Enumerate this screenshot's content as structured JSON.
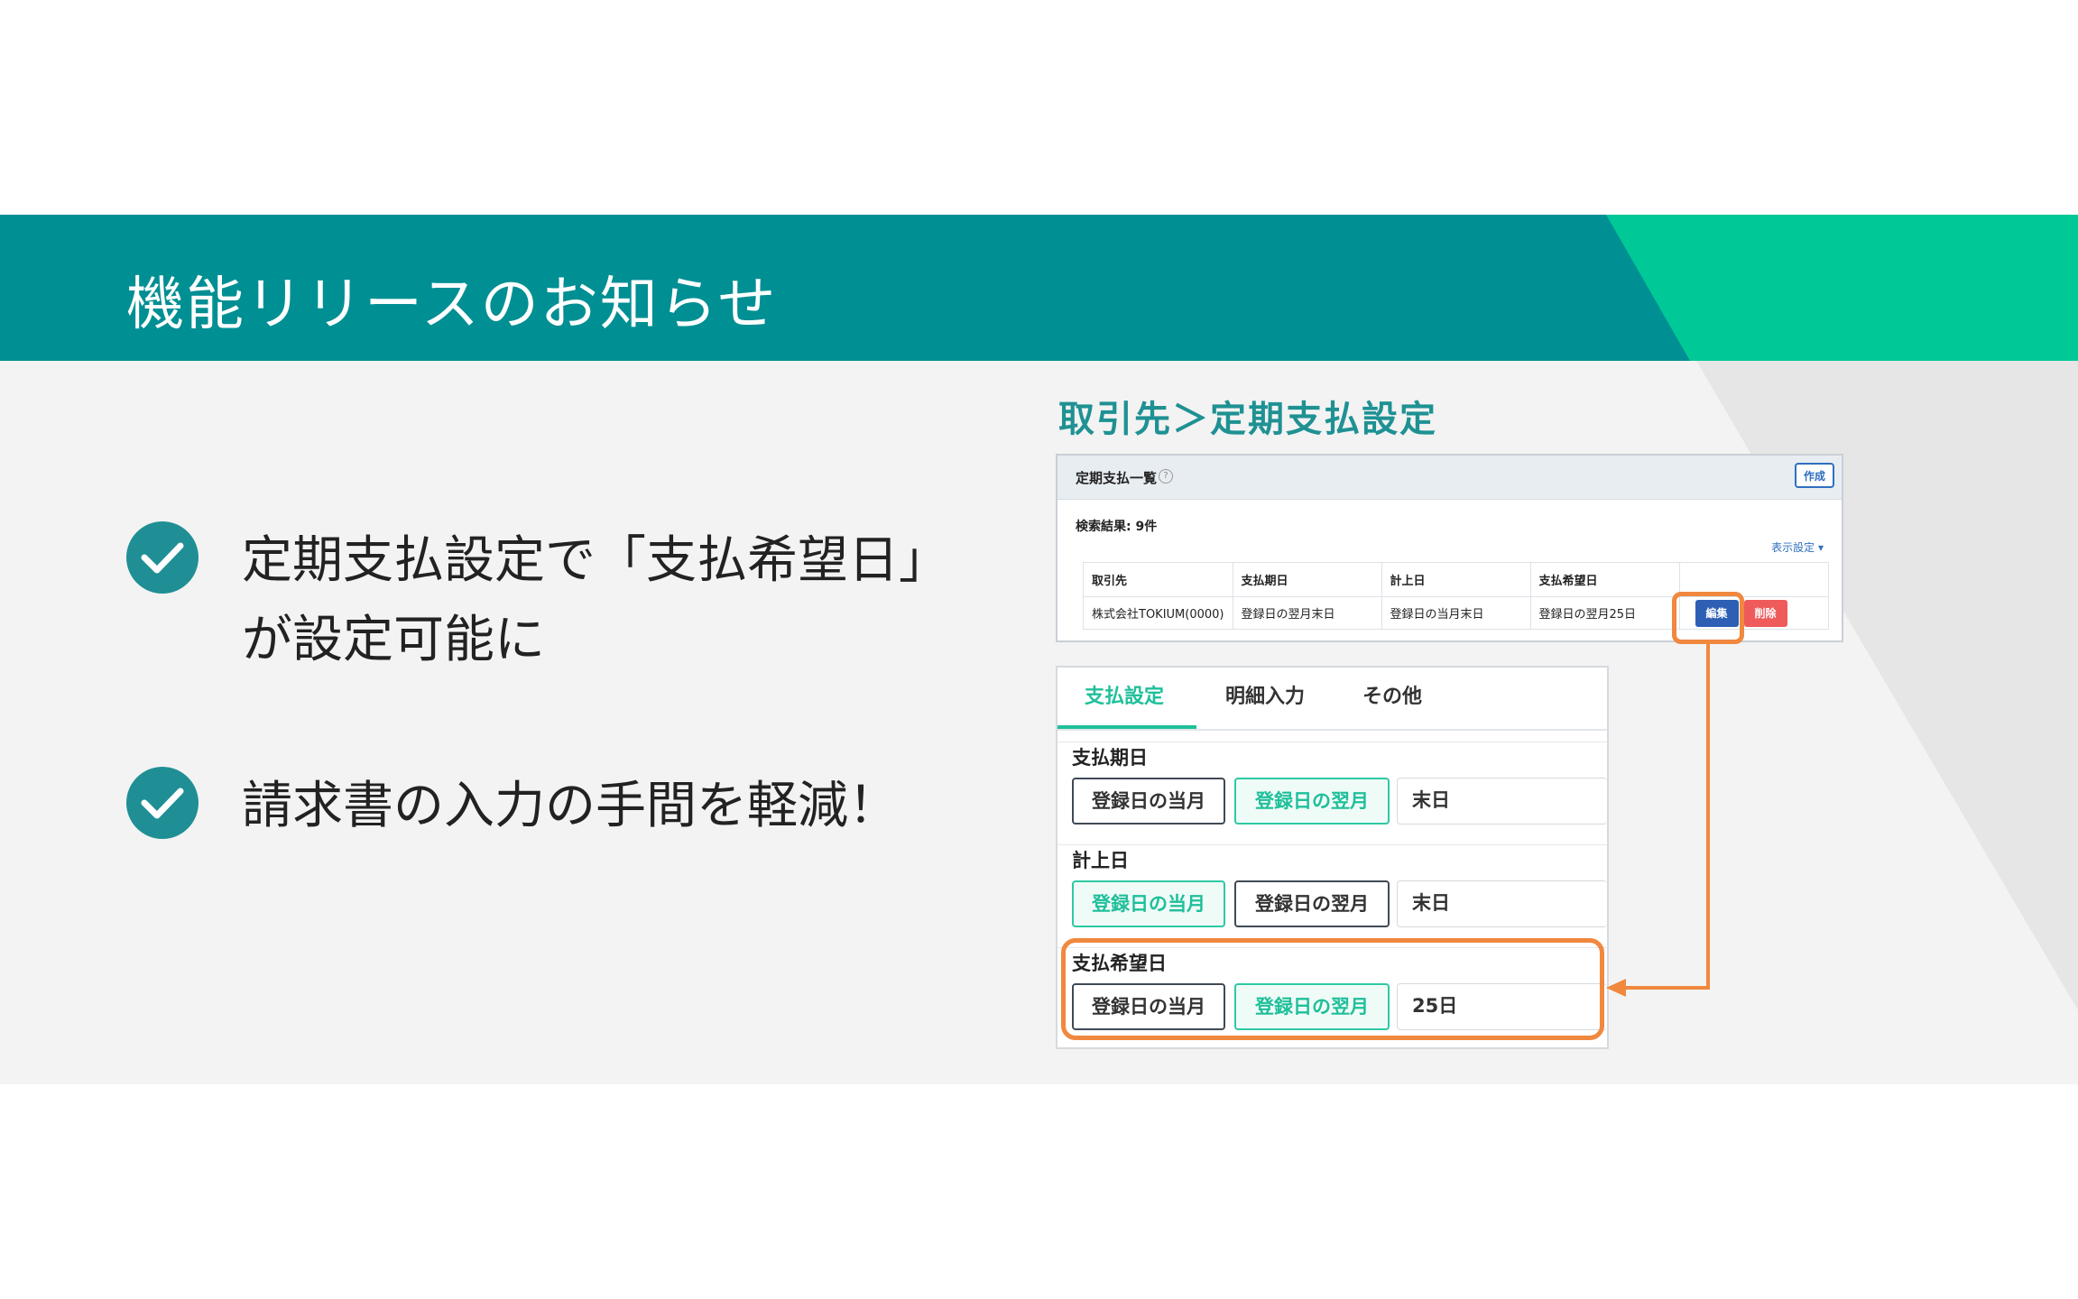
{
  "header": {
    "title": "機能リリースのお知らせ"
  },
  "bullets": [
    {
      "line1": "定期支払設定で「支払希望日」",
      "line2": "が設定可能に"
    },
    {
      "line1": "請求書の入力の手間を軽減！"
    }
  ],
  "section_label": "取引先＞定期支払設定",
  "list_panel": {
    "title": "定期支払一覧",
    "create_label": "作成",
    "search_result": "検索結果: 9件",
    "display_settings": "表示設定 ▾",
    "columns": [
      "取引先",
      "支払期日",
      "計上日",
      "支払希望日"
    ],
    "row": [
      "株式会社TOKIUM(0000)",
      "登録日の翌月末日",
      "登録日の当月末日",
      "登録日の翌月25日"
    ],
    "edit_label": "編集",
    "delete_label": "削除"
  },
  "settings_panel": {
    "tabs": [
      "支払設定",
      "明細入力",
      "その他"
    ],
    "fields": [
      {
        "label": "支払期日",
        "options": [
          "登録日の当月",
          "登録日の翌月"
        ],
        "value": "末日"
      },
      {
        "label": "計上日",
        "options": [
          "登録日の当月",
          "登録日の翌月"
        ],
        "value": "末日"
      },
      {
        "label": "支払希望日",
        "options": [
          "登録日の当月",
          "登録日の翌月"
        ],
        "value": "25日"
      }
    ]
  },
  "colors": {
    "header_teal": "#008f93",
    "header_green": "#00c896",
    "accent_orange": "#f0883e",
    "active_tab": "#1fbf9a"
  }
}
